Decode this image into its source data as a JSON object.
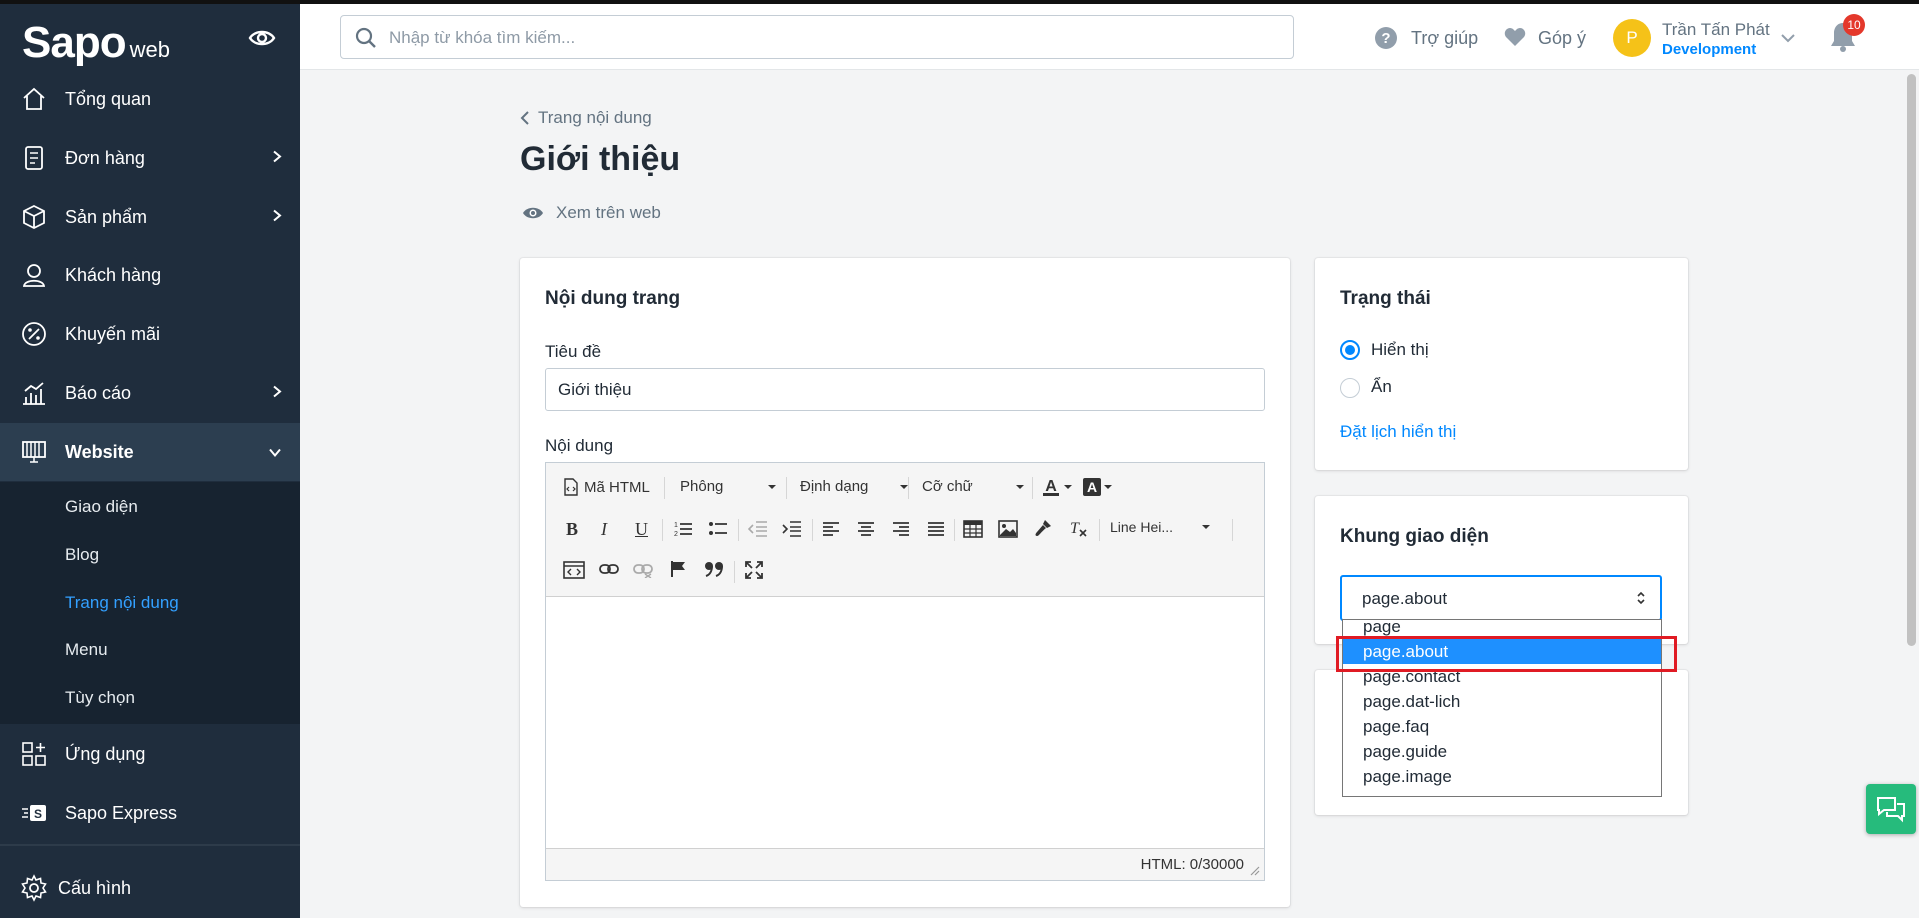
{
  "app": {
    "brand": "Sapo",
    "brand_suffix": "web"
  },
  "sidebar": {
    "items": [
      {
        "label": "Tổng quan",
        "icon": "home-icon"
      },
      {
        "label": "Đơn hàng",
        "icon": "order-icon",
        "has_children": true
      },
      {
        "label": "Sản phẩm",
        "icon": "box-icon",
        "has_children": true
      },
      {
        "label": "Khách hàng",
        "icon": "user-icon"
      },
      {
        "label": "Khuyến mãi",
        "icon": "percent-icon"
      },
      {
        "label": "Báo cáo",
        "icon": "chart-icon",
        "has_children": true
      },
      {
        "label": "Website",
        "icon": "monitor-icon",
        "expanded": true
      },
      {
        "label": "Ứng dụng",
        "icon": "apps-icon"
      },
      {
        "label": "Sapo Express",
        "icon": "express-icon"
      },
      {
        "label": "Cấu hình",
        "icon": "gear-icon"
      }
    ],
    "subitems": [
      "Giao diện",
      "Blog",
      "Trang nội dung",
      "Menu",
      "Tùy chọn"
    ],
    "active_subitem": "Trang nội dung"
  },
  "header": {
    "search_placeholder": "Nhập từ khóa tìm kiếm...",
    "help_label": "Trợ giúp",
    "feedback_label": "Góp ý",
    "user_initial": "P",
    "user_name": "Trần Tấn Phát",
    "user_role": "Development",
    "notification_count": "10"
  },
  "page": {
    "breadcrumb": "Trang nội dung",
    "title": "Giới thiệu",
    "view_on_web": "Xem trên web"
  },
  "content_card": {
    "title": "Nội dung trang",
    "title_label": "Tiêu đề",
    "title_value": "Giới thiệu",
    "content_label": "Nội dung",
    "toolbar": {
      "html_code": "Mã HTML",
      "font": "Phông",
      "format": "Định dạng",
      "font_size": "Cỡ chữ",
      "line_height": "Line Hei..."
    },
    "status": "HTML: 0/30000"
  },
  "status_card": {
    "title": "Trạng thái",
    "options": [
      "Hiển thị",
      "Ẩn"
    ],
    "selected": "Hiển thị",
    "schedule_link": "Đặt lịch hiển thị"
  },
  "template_card": {
    "title": "Khung giao diện",
    "selected": "page.about",
    "options": [
      "page",
      "page.about",
      "page.contact",
      "page.dat-lich",
      "page.faq",
      "page.guide",
      "page.image"
    ]
  },
  "colors": {
    "accent": "#0088ff",
    "sidebar": "#1f2d3d",
    "highlight": "#e01b24"
  }
}
